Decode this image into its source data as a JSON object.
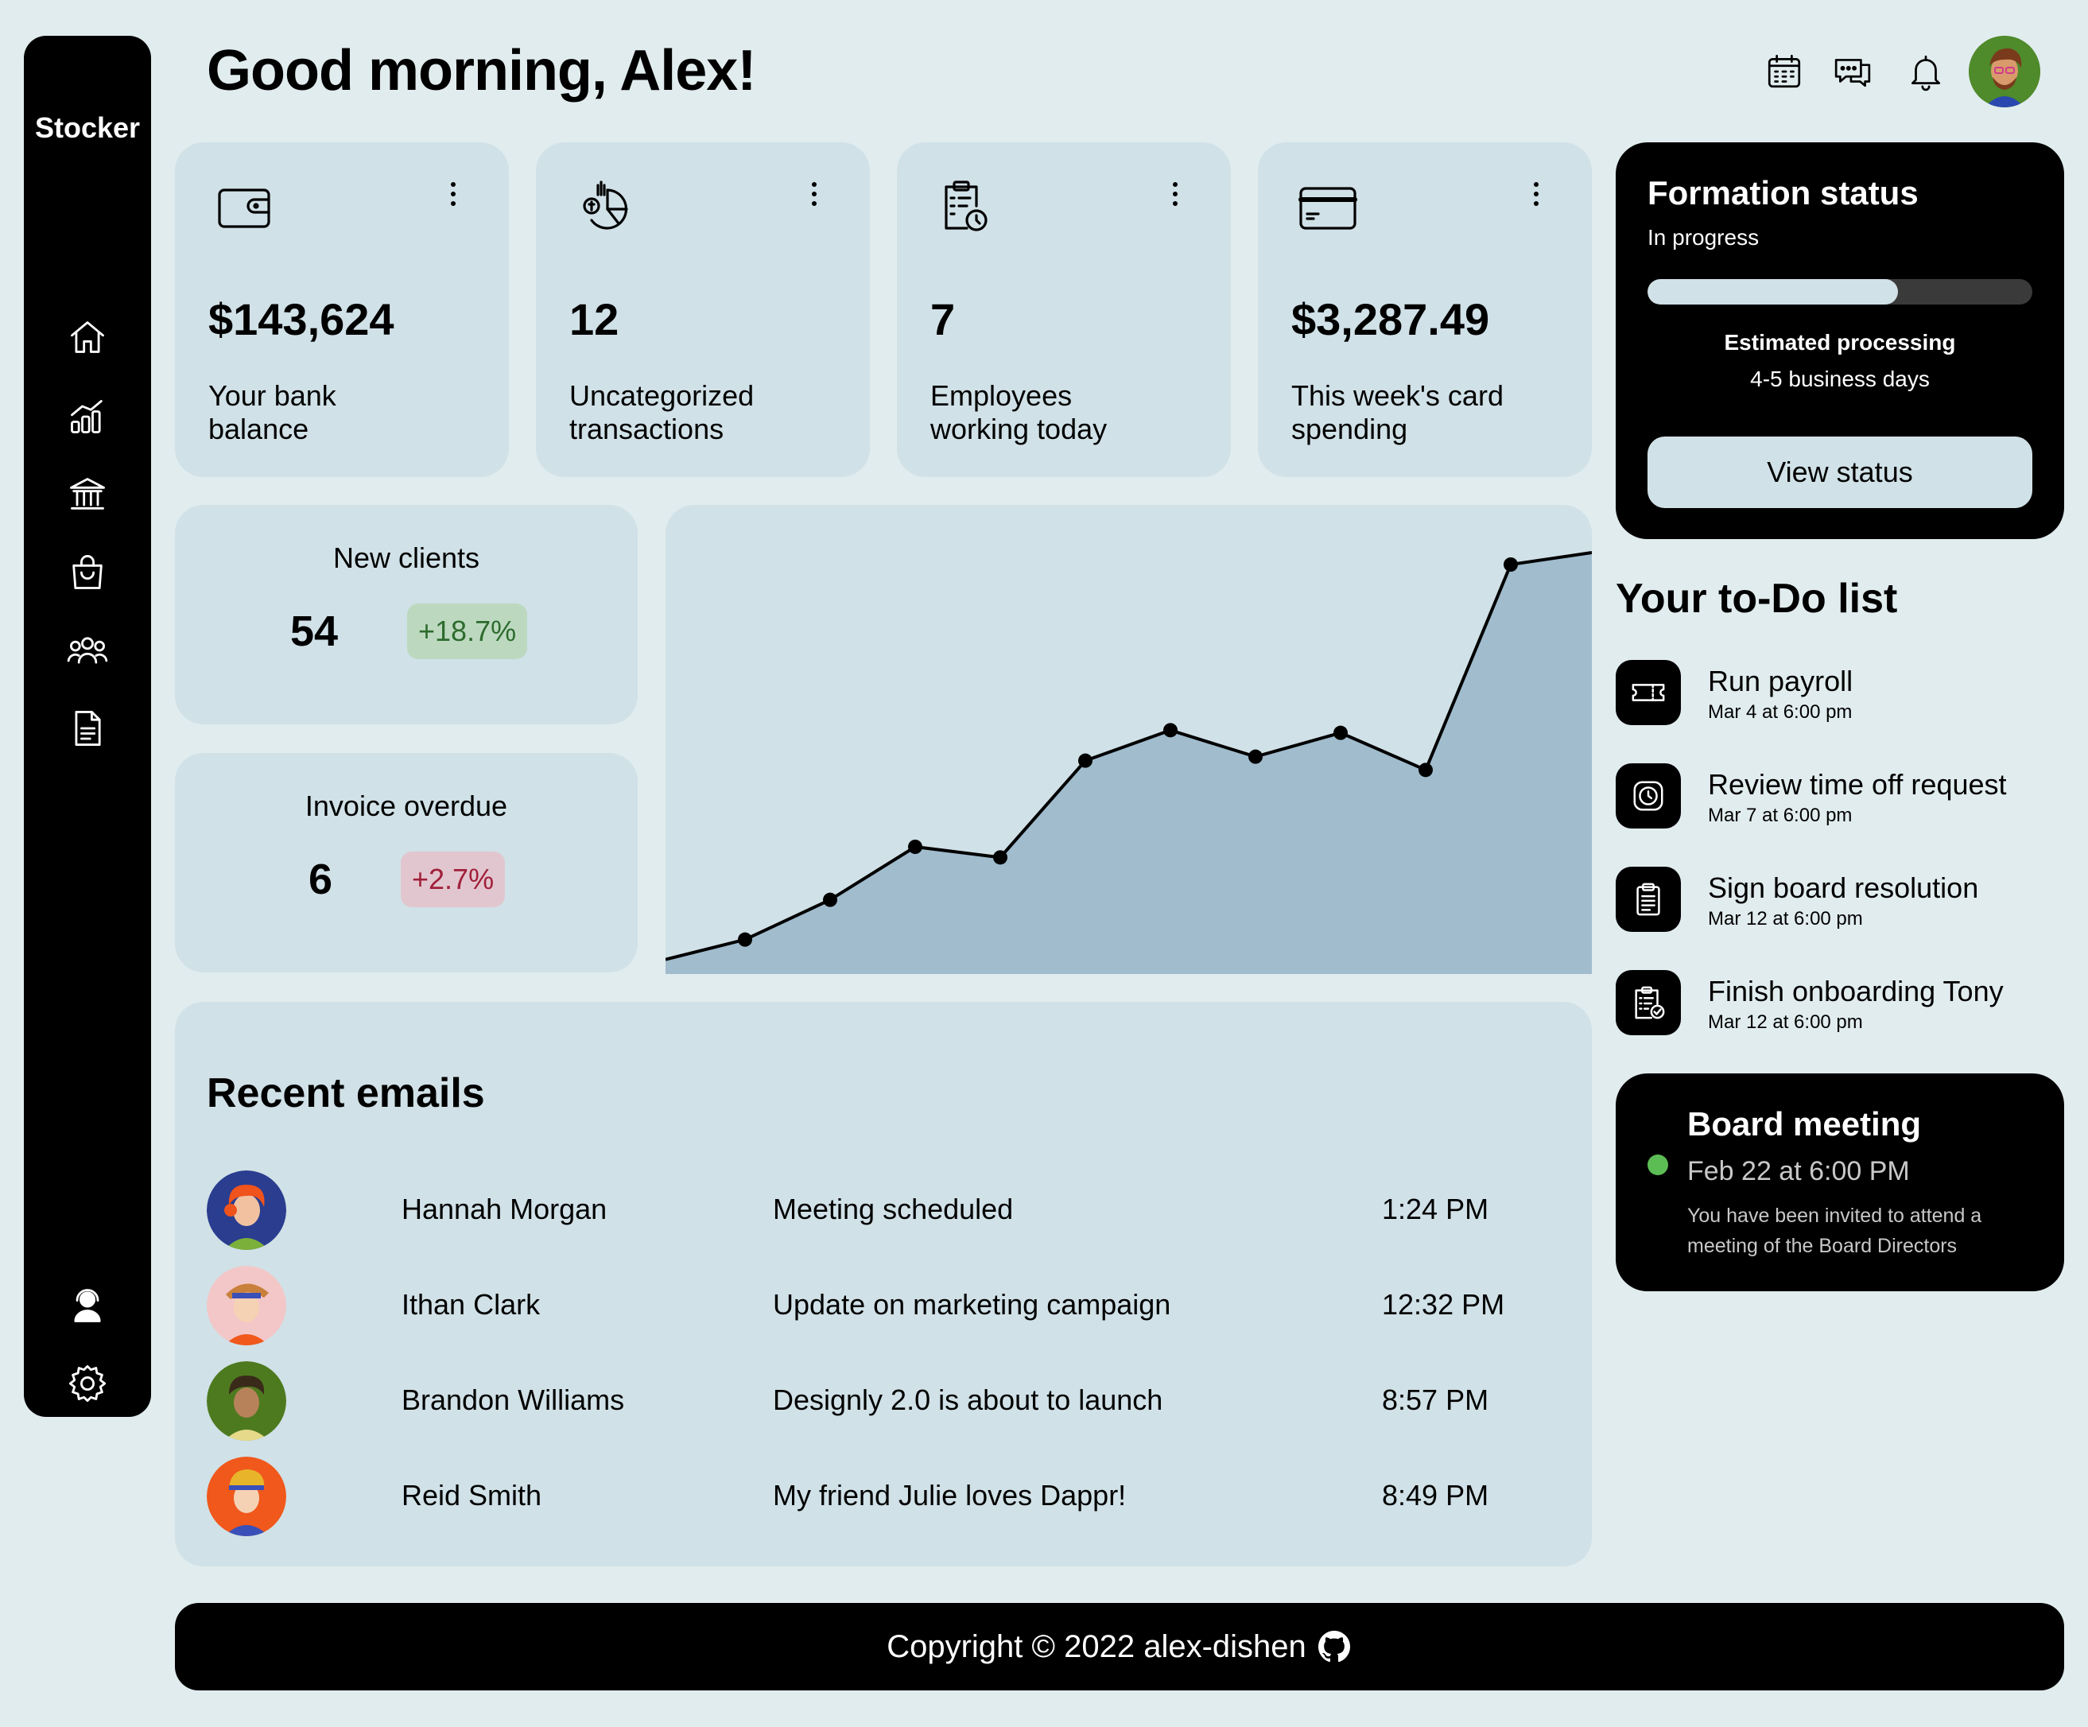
{
  "app": {
    "brand": "Stocker",
    "greeting": "Good morning, Alex!"
  },
  "sidebar": {
    "nav": [
      "home-icon",
      "analytics-icon",
      "bank-icon",
      "shopping-bag-icon",
      "team-icon",
      "document-icon"
    ],
    "bottom": [
      "support-agent-icon",
      "settings-icon"
    ]
  },
  "header": {
    "icons": [
      "calendar-icon",
      "chat-icon",
      "bell-icon"
    ],
    "avatar": "user-avatar"
  },
  "stats": [
    {
      "icon": "wallet-icon",
      "value": "$143,624",
      "label": "Your bank balance"
    },
    {
      "icon": "pie-chart-icon",
      "value": "12",
      "label": "Uncategorized transactions"
    },
    {
      "icon": "clipboard-clock-icon",
      "value": "7",
      "label": "Employees working today"
    },
    {
      "icon": "credit-card-icon",
      "value": "$3,287.49",
      "label": "This week's card spending"
    }
  ],
  "metrics": {
    "new_clients": {
      "title": "New clients",
      "value": "54",
      "change": "+18.7%"
    },
    "invoice_overdue": {
      "title": "Invoice overdue",
      "value": "6",
      "change": "+2.7%"
    }
  },
  "chart_data": {
    "type": "area",
    "x": [
      0,
      1,
      2,
      3,
      4,
      5,
      6,
      7,
      8,
      9,
      10,
      11
    ],
    "values": [
      5,
      20,
      50,
      90,
      82,
      155,
      178,
      158,
      176,
      148,
      303,
      312
    ],
    "ylim": [
      0,
      312
    ],
    "fill": "#a0bccd",
    "line": "#000000",
    "grid": false,
    "title": "",
    "xlabel": "",
    "ylabel": ""
  },
  "emails": {
    "title": "Recent emails",
    "rows": [
      {
        "name": "Hannah Morgan",
        "subject": "Meeting scheduled",
        "time": "1:24 PM",
        "avatar_bg": "#2a3d8f"
      },
      {
        "name": "Ithan Clark",
        "subject": "Update on marketing campaign",
        "time": "12:32 PM",
        "avatar_bg": "#f3c7c7"
      },
      {
        "name": "Brandon Williams",
        "subject": "Designly 2.0 is about to launch",
        "time": "8:57 PM",
        "avatar_bg": "#4e7a1f"
      },
      {
        "name": "Reid Smith",
        "subject": "My friend Julie loves Dappr!",
        "time": "8:49 PM",
        "avatar_bg": "#f0581c"
      }
    ]
  },
  "formation": {
    "title": "Formation status",
    "status": "In progress",
    "progress": 0.65,
    "estimate_label": "Estimated processing",
    "estimate_value": "4-5 business days",
    "button": "View status"
  },
  "todo": {
    "title": "Your to-Do list",
    "items": [
      {
        "icon": "ticket-icon",
        "name": "Run payroll",
        "date": "Mar 4 at 6:00 pm"
      },
      {
        "icon": "clock-icon",
        "name": "Review time off request",
        "date": "Mar 7 at 6:00 pm"
      },
      {
        "icon": "clipboard-icon",
        "name": "Sign board resolution",
        "date": "Mar 12 at 6:00 pm"
      },
      {
        "icon": "checklist-icon",
        "name": "Finish onboarding Tony",
        "date": "Mar 12 at 6:00 pm"
      }
    ]
  },
  "board_meeting": {
    "title": "Board meeting",
    "date": "Feb 22 at 6:00 PM",
    "description": "You have been invited to attend a meeting of the Board Directors"
  },
  "footer": {
    "text": "Copyright © 2022 alex-dishen",
    "icon": "github-icon"
  },
  "colors": {
    "background": "#e1ecee",
    "card": "#d0e1e7",
    "dark": "#000000",
    "positive": "#2e6b2e",
    "negative": "#a0203a",
    "online": "#5cbd55"
  }
}
